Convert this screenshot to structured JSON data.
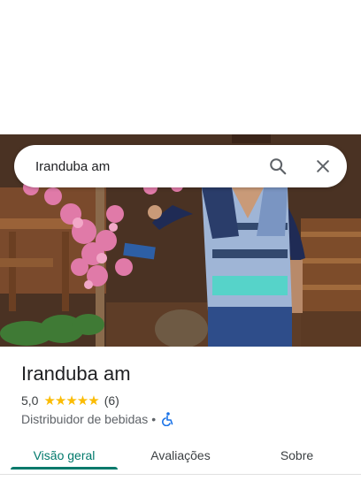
{
  "search": {
    "value": "Iranduba am",
    "search_icon": "search-icon",
    "close_icon": "close-icon"
  },
  "hero": {
    "image_subject": "photo of woman at waterfront deck with pink flowers"
  },
  "place": {
    "title": "Iranduba am",
    "rating": "5,0",
    "stars": "★★★★★",
    "review_count": "(6)",
    "category": "Distribuidor de bebidas",
    "separator": "•",
    "accessibility_icon": "wheelchair-icon"
  },
  "tabs": [
    {
      "label": "Visão geral",
      "active": true
    },
    {
      "label": "Avaliações",
      "active": false
    },
    {
      "label": "Sobre",
      "active": false
    }
  ],
  "colors": {
    "accent": "#00796b",
    "star": "#fbbc04",
    "wheelchair": "#1a73e8"
  }
}
